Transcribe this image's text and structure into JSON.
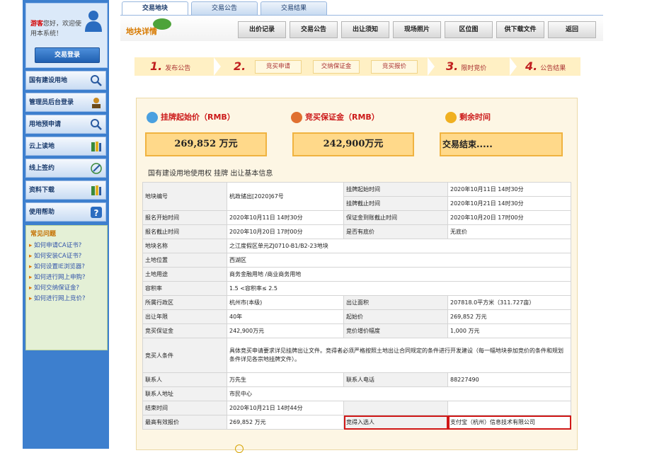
{
  "sidebar": {
    "guest_name": "游客",
    "greeting": "您好，欢迎使用本系统！",
    "login_button": "交易登录",
    "menu": [
      {
        "label": "国有建设用地",
        "icon": "search-icon"
      },
      {
        "label": "管理员后台登录",
        "icon": "admin-icon"
      },
      {
        "label": "用地预申请",
        "icon": "search-icon"
      },
      {
        "label": "云上读地",
        "icon": "book-icon"
      },
      {
        "label": "线上签约",
        "icon": "pen-icon"
      },
      {
        "label": "资料下载",
        "icon": "book-icon"
      },
      {
        "label": "使用帮助",
        "icon": "help-icon"
      }
    ],
    "faq_title": "常见问题",
    "faq": [
      "如何申请CA证书?",
      "如何安装CA证书?",
      "如何设置IE浏览器?",
      "如何进行网上申购?",
      "如何交纳保证金?",
      "如何进行网上竞价?"
    ]
  },
  "tabs": [
    "交易地块",
    "交易公告",
    "交易结果"
  ],
  "header": {
    "logo": "地块详情",
    "nav": [
      "出价记录",
      "交易公告",
      "出让须知",
      "现场照片",
      "区位图",
      "供下载文件",
      "返回"
    ]
  },
  "steps": {
    "s1_num": "1.",
    "s1_label": "发布公告",
    "s2_num": "2.",
    "s2_items": [
      "竞买申请",
      "交纳保证金",
      "竞买报价"
    ],
    "s3_num": "3.",
    "s3_label": "限时竞价",
    "s4_num": "4.",
    "s4_label": "公告结果"
  },
  "prices": {
    "start_label": "挂牌起始价（RMB）",
    "start_value": "269,852 万元",
    "deposit_label": "竞买保证金（RMB）",
    "deposit_value": "242,900万元",
    "remain_label": "剩余时间",
    "remain_value": "交易结束....."
  },
  "section_title": "国有建设用地使用权 挂牌 出让基本信息",
  "info": {
    "r1_k": "地块编号",
    "r1_v": "杭政储出[2020]67号",
    "r1_k2a": "挂牌起始时间",
    "r1_v2a": "2020年10月11日 14时30分",
    "r1_k2b": "挂牌截止时间",
    "r1_v2b": "2020年10月21日 14时30分",
    "r2_k": "报名开始时间",
    "r2_v": "2020年10月11日 14时30分",
    "r2_k2": "保证金到账截止时间",
    "r2_v2": "2020年10月20日 17时00分",
    "r3_k": "报名截止时间",
    "r3_v": "2020年10月20日 17时00分",
    "r3_k2": "是否有底价",
    "r3_v2": "无底价",
    "r4_k": "地块名称",
    "r4_v": "之江度假区单元ZJ0710-B1/B2-23地块",
    "r5_k": "土地位置",
    "r5_v": "西湖区",
    "r6_k": "土地用途",
    "r6_v": "商务金融用地 /商业商务用地",
    "r7_k": "容积率",
    "r7_v": "1.5 <容积率≤ 2.5",
    "r8_k": "所属行政区",
    "r8_v": "杭州市(本级)",
    "r8_k2": "出让面积",
    "r8_v2": "207818.0平方米（311.727亩）",
    "r9_k": "出让年限",
    "r9_v": "40年",
    "r9_k2": "起始价",
    "r9_v2": "269,852 万元",
    "r10_k": "竞买保证金",
    "r10_v": "242,900万元",
    "r10_k2": "竞价增价幅度",
    "r10_v2": "1,000 万元",
    "r11_k": "竞买人条件",
    "r11_v": "具体竞买申请要求详见挂牌出让文件。竞得者必须严格按照土地出让合同规定的条件进行开发建设（每一幅地块参加竞价的条件和规划条件详见各宗地挂牌文件）。",
    "r12_k": "联系人",
    "r12_v": "万先生",
    "r12_k2": "联系人电话",
    "r12_v2": "88227490",
    "r13_k": "联系人地址",
    "r13_v": "市民中心",
    "r14_k": "结束时间",
    "r14_v": "2020年10月21日 14时44分",
    "r15_k": "最高有效报价",
    "r15_v": "269,852 万元",
    "r15_k2": "竞得入选人",
    "r15_v2": "支付宝（杭州）信息技术有限公司"
  },
  "colors": {
    "accent": "#3d7fce",
    "highlight": "#d01818",
    "price_box": "#ffd98a"
  }
}
